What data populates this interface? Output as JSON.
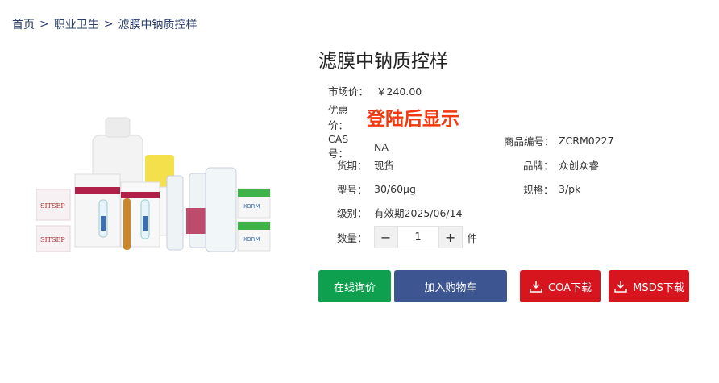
{
  "breadcrumb": {
    "home": "首页",
    "category": "职业卫生",
    "current": "滤膜中钠质控样",
    "separator": ">"
  },
  "product": {
    "title": "滤膜中钠质控样",
    "market_price_label": "市场价：",
    "market_price": "￥240.00",
    "promo_price_label": "优惠价：",
    "promo_price_text": "登陆后显示",
    "cas_label": "CAS号：",
    "cas": "NA",
    "product_no_label": "商品编号：",
    "product_no": "ZCRM0227",
    "delivery_label": "货期：",
    "delivery": "现货",
    "brand_label": "品牌：",
    "brand": "众创众睿",
    "model_label": "型号：",
    "model": "30/60μg",
    "spec_label": "规格：",
    "spec": "3/pk",
    "grade_label": "级别：",
    "grade": "有效期2025/06/14",
    "qty_label": "数量：",
    "qty_value": "1",
    "qty_unit": "件",
    "image_labels": {
      "box_brand": "SITSEP",
      "green_box_brand": "XBRM"
    }
  },
  "actions": {
    "inquiry": "在线询价",
    "cart": "加入购物车",
    "coa": "COA下载",
    "msds": "MSDS下载"
  },
  "colors": {
    "promo_red": "#f2380f",
    "inquiry_green": "#0fa04f",
    "cart_blue": "#3d5591",
    "download_red": "#d7151f",
    "breadcrumb_blue": "#2b3f6b"
  }
}
